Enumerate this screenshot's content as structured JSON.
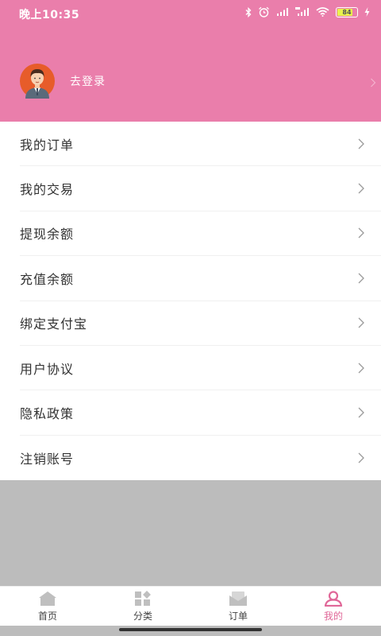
{
  "status_bar": {
    "time": "晚上10:35",
    "battery": "84",
    "battery_level": 0.84
  },
  "profile": {
    "login_text": "去登录",
    "avatar_icon": "avatar-man-icon"
  },
  "menu": {
    "items": [
      {
        "label": "我的订单"
      },
      {
        "label": "我的交易"
      },
      {
        "label": "提现余额"
      },
      {
        "label": "充值余额"
      },
      {
        "label": "绑定支付宝"
      },
      {
        "label": "用户协议"
      },
      {
        "label": "隐私政策"
      },
      {
        "label": "注销账号"
      }
    ]
  },
  "tabbar": {
    "tabs": [
      {
        "label": "首页",
        "icon": "home-icon"
      },
      {
        "label": "分类",
        "icon": "category-icon"
      },
      {
        "label": "订单",
        "icon": "order-icon"
      },
      {
        "label": "我的",
        "icon": "user-icon",
        "active": true
      }
    ]
  },
  "colors": {
    "header_bg": "#ea7eab",
    "active_tab": "#e06798",
    "inactive_icon": "#bfbfbf",
    "page_bg": "#bcbcbc"
  }
}
